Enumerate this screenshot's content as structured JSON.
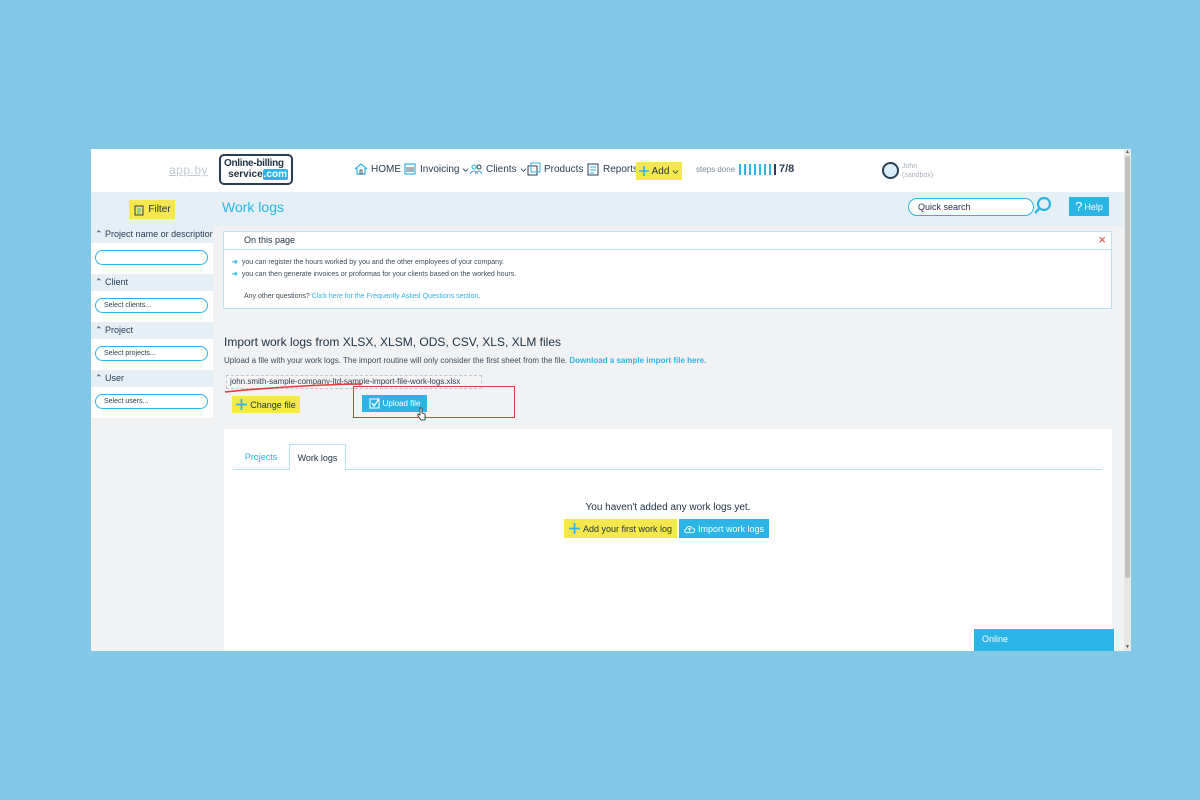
{
  "navbar": {
    "brand_small": "app.by",
    "logo_line1": "Online-billing",
    "logo_line2": "service",
    "logo_tld": ".com",
    "home": "HOME",
    "invoicing": "Invoicing",
    "clients": "Clients",
    "products": "Products",
    "reports": "Reports",
    "add": "Add",
    "steps_label": "steps done",
    "steps_count": "7/8",
    "steps_done": 7,
    "steps_total": 8,
    "user_name": "John",
    "user_sub": "(sandbox)"
  },
  "sidebar": {
    "filter": "Filter",
    "groups": [
      {
        "title": "Project name or description",
        "placeholder": ""
      },
      {
        "title": "Client",
        "placeholder": "Select clients..."
      },
      {
        "title": "Project",
        "placeholder": "Select projects..."
      },
      {
        "title": "User",
        "placeholder": "Select users..."
      }
    ]
  },
  "header": {
    "title": "Work logs",
    "search_placeholder": "Quick search",
    "help": "Help"
  },
  "info": {
    "title": "On this page",
    "close": "×",
    "bullet1": "you can register the hours worked by you and the other employees of your company.",
    "bullet2": "you can then generate invoices or proformas for your clients based on the worked hours.",
    "question_prefix": "Any other questions?",
    "question_link": "Click here for the Frequently Asked Questions section",
    "question_suffix": "."
  },
  "import": {
    "title": "Import work logs from XLSX, XLSM, ODS, CSV, XLS, XLM files",
    "desc": "Upload a file with your work logs. The import routine will only consider the first sheet from the file.",
    "desc_link": "Download a sample import file here.",
    "file_name": "john.smith-sample-company-ltd-sample-import-file-work-logs.xlsx",
    "change_file": "Change file",
    "upload_file": "Upload file"
  },
  "panel": {
    "tabs": [
      "Projects",
      "Work logs"
    ],
    "active_tab": "Work logs",
    "empty_msg": "You haven't added any work logs yet.",
    "add_first": "Add your first work log",
    "import_logs": "Import work logs"
  },
  "chat": {
    "label": "Online"
  },
  "colors": {
    "accent": "#2bb5e6",
    "yellow": "#f6e84c",
    "dark": "#1f3142",
    "danger": "#e53838",
    "background": "#83c8e6"
  }
}
